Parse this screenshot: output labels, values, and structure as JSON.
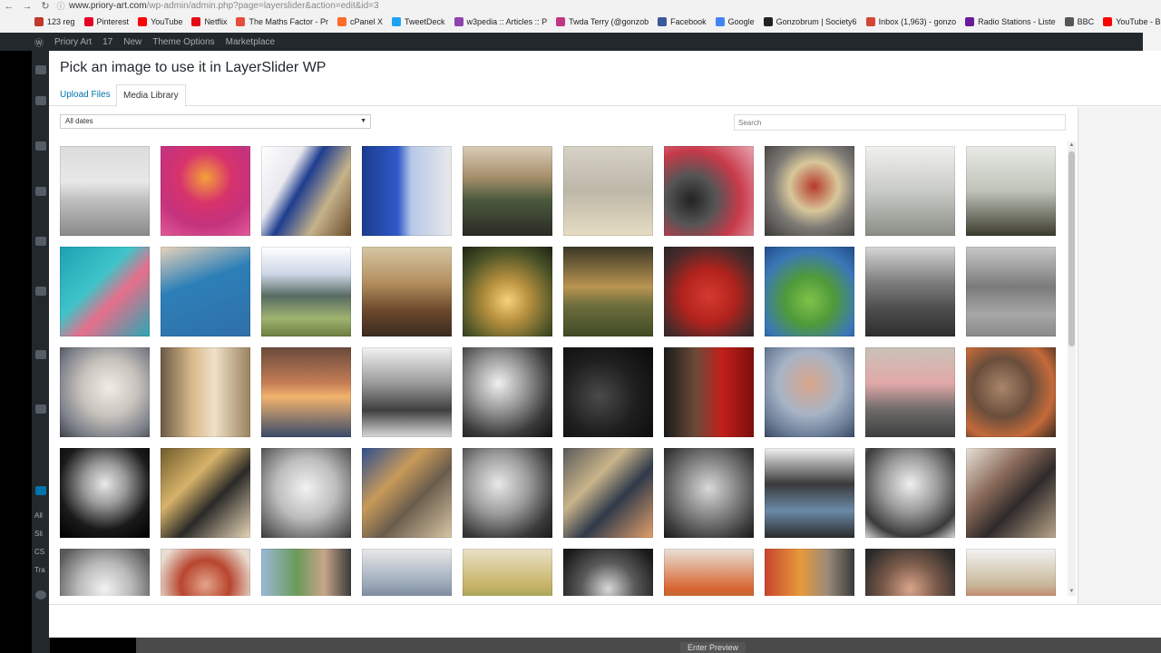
{
  "browser": {
    "url_host": "www.priory-art.com",
    "url_path": "/wp-admin/admin.php?page=layerslider&action=edit&id=3",
    "bookmarks": [
      {
        "label": "123 reg",
        "color": "#c0392b",
        "icon": "grid-icon"
      },
      {
        "label": "Pinterest",
        "color": "#e60023",
        "icon": "pinterest-icon"
      },
      {
        "label": "YouTube",
        "color": "#ff0000",
        "icon": "youtube-icon"
      },
      {
        "label": "Netflix",
        "color": "#e50914",
        "icon": "netflix-icon"
      },
      {
        "label": "The Maths Factor - Pr",
        "color": "#e74c3c",
        "icon": "globe-icon"
      },
      {
        "label": "cPanel X",
        "color": "#ff6c2c",
        "icon": "cpanel-icon"
      },
      {
        "label": "TweetDeck",
        "color": "#1da1f2",
        "icon": "tweetdeck-icon"
      },
      {
        "label": "w3pedia :: Articles :: P",
        "color": "#8e44ad",
        "icon": "w3pedia-icon"
      },
      {
        "label": "Twda Terry (@gonzob",
        "color": "#c13584",
        "icon": "instagram-icon"
      },
      {
        "label": "Facebook",
        "color": "#3b5998",
        "icon": "facebook-icon"
      },
      {
        "label": "Google",
        "color": "#4285f4",
        "icon": "google-icon"
      },
      {
        "label": "Gonzobrum | Society6",
        "color": "#222222",
        "icon": "society6-icon"
      },
      {
        "label": "Inbox (1,963) - gonzo",
        "color": "#d44638",
        "icon": "gmail-icon"
      },
      {
        "label": "Radio Stations - Liste",
        "color": "#6a1b9a",
        "icon": "radio-icon"
      },
      {
        "label": "BBC",
        "color": "#555555",
        "icon": "bbc-icon"
      },
      {
        "label": "YouTube - Broadcast",
        "color": "#ff0000",
        "icon": "youtube-icon"
      }
    ]
  },
  "wp": {
    "site_name": "Priory Art",
    "comments_count": "17",
    "new_label": "New",
    "theme_options": "Theme Options",
    "marketplace": "Marketplace",
    "sidebar_labels": [
      "All",
      "Sli",
      "CS",
      "Tra"
    ],
    "bottom_button": "Enter Preview"
  },
  "modal": {
    "title": "Pick an image to use it in LayerSlider WP",
    "tabs": [
      {
        "label": "Upload Files",
        "active": false
      },
      {
        "label": "Media Library",
        "active": true
      }
    ],
    "filter_value": "All dates",
    "search_placeholder": "Search"
  },
  "media_grid": {
    "columns": 10,
    "thumbnails": [
      {
        "bg": "linear-gradient(180deg,#dcdcdc 0%,#e8e8e8 40%,#bfbfbf 60%,#8a8a8a 100%)"
      },
      {
        "bg": "radial-gradient(circle at 50% 35%,#f2a23a 0%,#d8336b 35%,#c4327e 65%,#e15b98 100%)"
      },
      {
        "bg": "linear-gradient(120deg,#ffffff 0%,#e9e9ef 30%,#1f3d8f 45%,#c5b38a 70%,#6b4b2a 100%)"
      },
      {
        "bg": "linear-gradient(90deg,#1b3b8c 0%,#2f5ac9 40%,#b7c8e8 55%,#e9e9e9 100%)"
      },
      {
        "bg": "linear-gradient(180deg,#d9cdb8 0%,#a58e6a 35%,#4b5a3e 60%,#2b2a25 100%)"
      },
      {
        "bg": "linear-gradient(180deg,#d6d2c6 0%,#bdb7a8 50%,#e6dcc2 100%)"
      },
      {
        "bg": "radial-gradient(circle at 30% 60%,#222 0%,#555 30%,#c73a4a 60%,#e9a7b3 100%)"
      },
      {
        "bg": "radial-gradient(circle at 55% 45%,#b53a2c 0%,#d8c79a 35%,#7d7a76 60%,#3a3836 100%)"
      },
      {
        "bg": "linear-gradient(180deg,#f1f1ef 0%,#c9cbc6 50%,#8a8c86 100%)"
      },
      {
        "bg": "linear-gradient(180deg,#e9ebe6 0%,#bfc3b8 50%,#3a3b2d 100%)"
      },
      {
        "bg": "linear-gradient(135deg,#1da0b3 0%,#3fc4c9 40%,#e76e8a 60%,#2ba6b6 100%)"
      },
      {
        "bg": "linear-gradient(160deg,#e9d3b9 0%,#2d7fb8 40%,#2f6fa8 100%)"
      },
      {
        "bg": "linear-gradient(180deg,#ffffff 0%,#cfd8e8 30%,#586b63 55%,#9fb46f 80%,#6c7d41 100%)"
      },
      {
        "bg": "linear-gradient(180deg,#d5c7a5 0%,#b38f5e 40%,#6e4a2d 70%,#3a2a20 100%)"
      },
      {
        "bg": "radial-gradient(circle at 50% 60%,#f6d27a 0%,#b9923f 30%,#4a5227 70%,#1c2312 100%)"
      },
      {
        "bg": "linear-gradient(180deg,#3b3626 0%,#b99551 45%,#6f6e3e 65%,#3f4a25 100%)"
      },
      {
        "bg": "radial-gradient(circle at 50% 55%,#d43a2f 0%,#b2231d 40%,#4b2a2a 75%,#2a2525 100%)"
      },
      {
        "bg": "radial-gradient(circle at 50% 60%,#7fc24a 0%,#4f9a3a 35%,#3b78b6 70%,#214c8a 100%)"
      },
      {
        "bg": "linear-gradient(180deg,#d6d6d6 0%,#7d7d7d 40%,#4c4c4c 70%,#2f2f2f 100%)"
      },
      {
        "bg": "linear-gradient(180deg,#c8c8c8 0%,#7a7a7a 45%,#a7a7a7 75%,#8a8a8a 100%)"
      },
      {
        "bg": "radial-gradient(circle at 55% 45%,#f0ece6 0%,#c9c3bd 40%,#7b7f88 75%,#3d4048 100%)"
      },
      {
        "bg": "linear-gradient(90deg,#6a5a45 0%,#d9b98b 35%,#efe1c7 60%,#9b8260 100%)"
      },
      {
        "bg": "linear-gradient(180deg,#6a4a3c 0%,#c57d55 40%,#f2b46d 55%,#3a4a6a 100%)"
      },
      {
        "bg": "linear-gradient(180deg,#f3f3f3 0%,#9a9a9a 40%,#3f3f3f 70%,#d9d9d9 100%)"
      },
      {
        "bg": "radial-gradient(circle at 40% 40%,#f0f0f0 0%,#9a9a9a 35%,#3a3a3a 70%,#111 100%)"
      },
      {
        "bg": "radial-gradient(circle at 40% 55%,#4a4a4a 0%,#1f1f1f 50%,#0a0a0a 100%)"
      },
      {
        "bg": "linear-gradient(90deg,#1a1a1a 0%,#6b4a3a 35%,#c21f1a 65%,#7a0f0d 100%)"
      },
      {
        "bg": "radial-gradient(circle at 50% 40%,#d9a58a 0%,#a7b4c6 45%,#6e7f99 75%,#3a4a63 100%)"
      },
      {
        "bg": "linear-gradient(180deg,#c9c2b8 0%,#e2a8a8 40%,#6b6a68 70%,#3f3f3f 100%)"
      },
      {
        "bg": "radial-gradient(circle at 40% 45%,#a9856a 0%,#6a4e3c 40%,#c46a3a 70%,#3a2a20 100%)"
      },
      {
        "bg": "radial-gradient(circle at 50% 40%,#e9e9e9 0%,#9a9a9a 30%,#1a1a1a 65%,#000 100%)"
      },
      {
        "bg": "linear-gradient(135deg,#6f5a2a 0%,#d7b36a 35%,#2b2a28 60%,#e8d7b8 100%)"
      },
      {
        "bg": "radial-gradient(circle at 50% 45%,#f2f2f2 0%,#bdbdbd 45%,#6a6a6a 80%,#3a3a3a 100%)"
      },
      {
        "bg": "linear-gradient(135deg,#2f4f8f 0%,#c79a5a 35%,#6a5c4c 60%,#d9c7a5 100%)"
      },
      {
        "bg": "radial-gradient(circle at 40% 40%,#e9e9e9 0%,#9a9a9a 40%,#3a3a3a 75%,#1a1a1a 100%)"
      },
      {
        "bg": "linear-gradient(135deg,#5a5a5a 0%,#c9b48a 35%,#2f3a4a 60%,#e3a06a 100%)"
      },
      {
        "bg": "radial-gradient(circle at 50% 45%,#d9d9d9 0%,#8a8a8a 40%,#3a3a3a 80%,#1a1a1a 100%)"
      },
      {
        "bg": "linear-gradient(180deg,#f3f3f3 0%,#3a3a3a 40%,#6a8aa8 70%,#2a2a2a 100%)"
      },
      {
        "bg": "radial-gradient(circle at 50% 40%,#f0f0f0 0%,#9a9a9a 40%,#3a3a3a 75%,#dcdcdc 100%)"
      },
      {
        "bg": "linear-gradient(135deg,#e9e2d8 0%,#8a6a5a 35%,#2f2a2a 60%,#b9a58a 100%)"
      },
      {
        "bg": "radial-gradient(circle at 50% 45%,#f3f3f3 0%,#b9b9b9 40%,#5a5a5a 80%)"
      },
      {
        "bg": "radial-gradient(circle at 50% 40%,#e3a48a 0%,#b8452f 35%,#e8ddd0 70%)"
      },
      {
        "bg": "linear-gradient(90deg,#9ab8d8 0%,#6a9a5a 40%,#c8a58a 70%,#3a3a3a 100%)"
      },
      {
        "bg": "linear-gradient(180deg,#e9e9e9 0%,#9aa8b8 40%,#3a4a6a 80%)"
      },
      {
        "bg": "linear-gradient(180deg,#e9e2c8 0%,#c9b46a 40%,#6a8a3a 80%)"
      },
      {
        "bg": "radial-gradient(circle at 50% 45%,#d9d9d9 0%,#5a5a5a 40%,#1a1a1a 80%)"
      },
      {
        "bg": "linear-gradient(180deg,#e8e2d8 0%,#d8632f 45%,#6a8a3a 80%)"
      },
      {
        "bg": "linear-gradient(90deg,#c8452f 0%,#e89a3a 40%,#9a8a7a 70%,#3a3a3a 100%)"
      },
      {
        "bg": "radial-gradient(circle at 50% 45%,#d9a58a 0%,#7a5a4a 40%,#2a2a2a 80%)"
      },
      {
        "bg": "linear-gradient(180deg,#f3f3f3 0%,#c8b89a 40%,#b84a3a 70%,#3a3a3a 100%)"
      }
    ]
  }
}
